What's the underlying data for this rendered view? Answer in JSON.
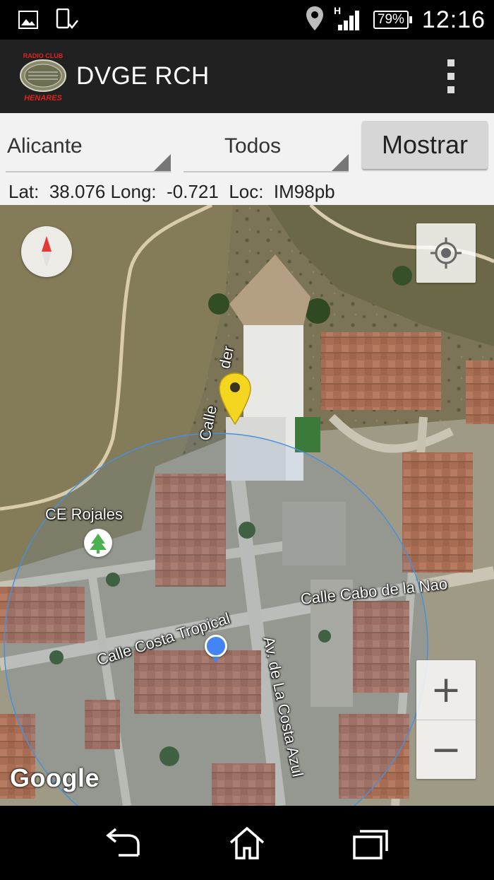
{
  "status_bar": {
    "time": "12:16",
    "battery": "79%",
    "network": "H",
    "icons": [
      "image-icon",
      "phone-sync-icon",
      "location-pin-icon",
      "signal-icon",
      "battery-icon"
    ]
  },
  "app_bar": {
    "title": "DVGE RCH",
    "logo_text_top": "RADIO CLUB",
    "logo_text_bottom": "HENARES",
    "menu_icon": "overflow-menu-icon"
  },
  "controls": {
    "province_select": "Alicante",
    "type_select": "Todos",
    "show_button": "Mostrar",
    "lat_label": "Lat:",
    "lat_value": "38.076",
    "long_label": "Long:",
    "long_value": "-0.721",
    "loc_label": "Loc:",
    "loc_value": "IM98pb"
  },
  "map": {
    "labels": {
      "poi": "CE Rojales",
      "street_1": "Calle Cabo de la Nao",
      "street_2": "Calle Costa Tropical",
      "street_3": "Av. de La Costa Azul",
      "street_4": "Calle",
      "street_5": "der"
    },
    "attribution": "Google",
    "zoom_in": "+",
    "zoom_out": "−",
    "colors": {
      "marker": "#f4d520",
      "user_dot": "#4285f4",
      "accuracy_circle": "#4a90d9"
    }
  },
  "nav_bar": {
    "icons": [
      "back-icon",
      "home-icon",
      "recents-icon"
    ]
  }
}
